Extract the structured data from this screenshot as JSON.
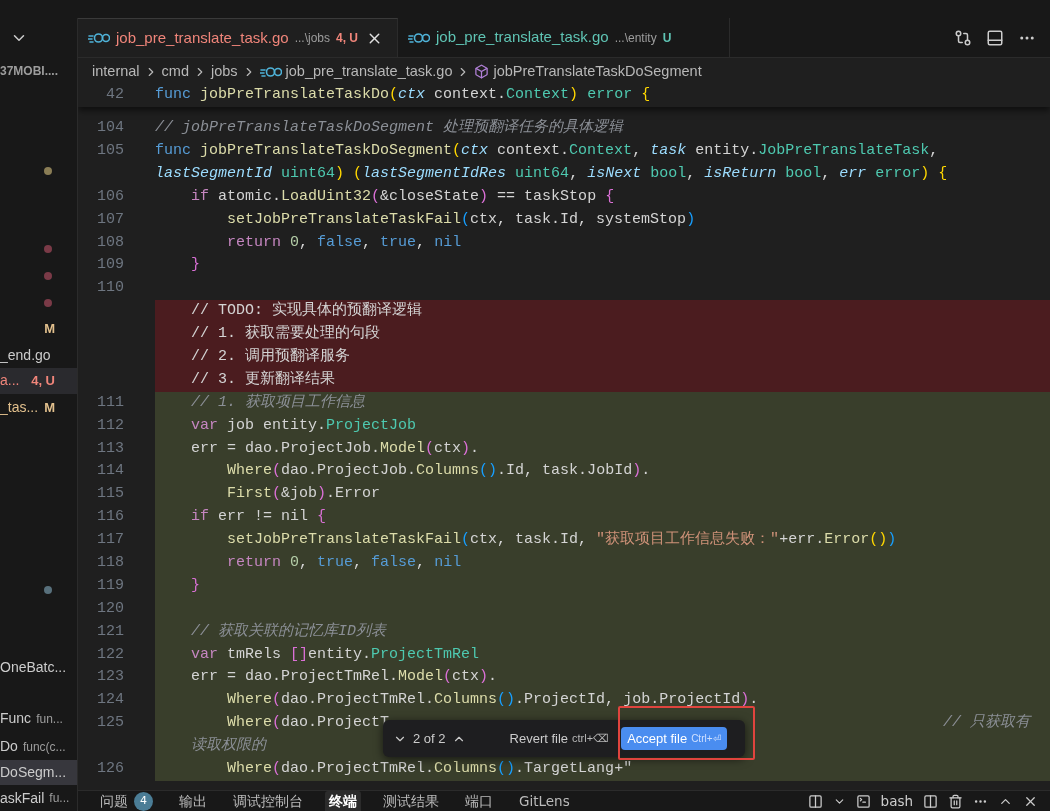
{
  "tabs": [
    {
      "label": "job_pre_translate_task.go",
      "path": "...\\jobs",
      "status": "4, U",
      "color": "#f0857a",
      "selected": true
    },
    {
      "label": "job_pre_translate_task.go",
      "path": "...\\entity",
      "status": "U",
      "color": "#5fc4b4",
      "selected": false
    }
  ],
  "breadcrumb": {
    "folders": [
      "internal",
      "cmd",
      "jobs"
    ],
    "file": "job_pre_translate_task.go",
    "symbol": "jobPreTranslateTaskDoSegment"
  },
  "sidebar": {
    "header": "37MOBI....",
    "items": [
      {
        "kind": "dot",
        "color": "#8a7d55"
      },
      {
        "kind": "dot",
        "color": "#7a3a47"
      },
      {
        "kind": "dot",
        "color": "#7a3a47"
      },
      {
        "kind": "dot",
        "color": "#7a3a47"
      },
      {
        "kind": "file",
        "badge": "M",
        "color": "#e2c08d",
        "selected": false
      },
      {
        "kind": "file",
        "name": "_end.go",
        "color": "#cccccc",
        "selected": false
      },
      {
        "kind": "file",
        "name": "a...",
        "badge": "4, U",
        "color": "#f0857a",
        "selected": true
      },
      {
        "kind": "file",
        "name": "_tas...",
        "badge": "M",
        "color": "#e2c08d",
        "selected": false
      },
      {
        "kind": "dot",
        "color": "#58707c"
      },
      {
        "kind": "outline",
        "name": "OneBatc...",
        "selected": false
      },
      {
        "kind": "outline",
        "name": "Func",
        "detail": "fun...",
        "selected": false
      },
      {
        "kind": "outline",
        "name": "Do",
        "detail": "func(c...",
        "selected": false
      },
      {
        "kind": "outline",
        "name": "DoSegm...",
        "selected": true
      },
      {
        "kind": "outline",
        "name": "askFail",
        "detail": "fu...",
        "selected": false
      }
    ]
  },
  "sticky_line": {
    "number": "42",
    "tokens": [
      {
        "text": "func ",
        "kind": "keyword"
      },
      {
        "text": "jobPreTranslateTaskDo",
        "kind": "function"
      },
      {
        "text": "(",
        "kind": "brace"
      },
      {
        "text": "ctx ",
        "kind": "param"
      },
      {
        "text": "context.",
        "kind": "plain"
      },
      {
        "text": "Context",
        "kind": "type"
      },
      {
        "text": ") ",
        "kind": "brace"
      },
      {
        "text": "error ",
        "kind": "type"
      },
      {
        "text": "{",
        "kind": "brace"
      }
    ]
  },
  "code_lines": [
    {
      "number": "104",
      "kind": "context",
      "tokens": [
        {
          "text": "// jobPreTranslateTaskDoSegment 处理预翻译任务的具体逻辑",
          "kind": "comment"
        }
      ]
    },
    {
      "number": "105",
      "kind": "context",
      "tokens": [
        {
          "text": "func ",
          "kind": "keyword"
        },
        {
          "text": "jobPreTranslateTaskDoSegment",
          "kind": "function"
        },
        {
          "text": "(",
          "kind": "brace"
        },
        {
          "text": "ctx ",
          "kind": "param"
        },
        {
          "text": "context.",
          "kind": "plain"
        },
        {
          "text": "Context",
          "kind": "type"
        },
        {
          "text": ", ",
          "kind": "plain"
        },
        {
          "text": "task ",
          "kind": "param"
        },
        {
          "text": "entity.",
          "kind": "plain"
        },
        {
          "text": "JobPreTranslateTask",
          "kind": "type"
        },
        {
          "text": ",",
          "kind": "plain"
        }
      ]
    },
    {
      "kind": "context",
      "tokens": [
        {
          "text": "lastSegmentId ",
          "kind": "param"
        },
        {
          "text": "uint64",
          "kind": "type"
        },
        {
          "text": ") ",
          "kind": "brace"
        },
        {
          "text": "(",
          "kind": "brace"
        },
        {
          "text": "lastSegmentIdRes ",
          "kind": "param"
        },
        {
          "text": "uint64",
          "kind": "type"
        },
        {
          "text": ", ",
          "kind": "plain"
        },
        {
          "text": "isNext ",
          "kind": "param"
        },
        {
          "text": "bool",
          "kind": "type"
        },
        {
          "text": ", ",
          "kind": "plain"
        },
        {
          "text": "isReturn ",
          "kind": "param"
        },
        {
          "text": "bool",
          "kind": "type"
        },
        {
          "text": ", ",
          "kind": "plain"
        },
        {
          "text": "err ",
          "kind": "param"
        },
        {
          "text": "error",
          "kind": "type"
        },
        {
          "text": ") ",
          "kind": "brace"
        },
        {
          "text": "{",
          "kind": "brace"
        }
      ]
    },
    {
      "number": "106",
      "kind": "context",
      "tokens": [
        {
          "text": "    if ",
          "kind": "control"
        },
        {
          "text": "atomic.",
          "kind": "plain"
        },
        {
          "text": "LoadUint32",
          "kind": "function"
        },
        {
          "text": "(",
          "kind": "paren"
        },
        {
          "text": "&closeState",
          "kind": "plain"
        },
        {
          "text": ")",
          "kind": "paren"
        },
        {
          "text": " == taskStop ",
          "kind": "plain"
        },
        {
          "text": "{",
          "kind": "paren"
        }
      ]
    },
    {
      "number": "107",
      "kind": "context",
      "tokens": [
        {
          "text": "        setJobPreTranslateTaskFail",
          "kind": "function"
        },
        {
          "text": "(",
          "kind": "bracket"
        },
        {
          "text": "ctx, task.Id, systemStop",
          "kind": "plain"
        },
        {
          "text": ")",
          "kind": "bracket"
        }
      ]
    },
    {
      "number": "108",
      "kind": "context",
      "tokens": [
        {
          "text": "        return ",
          "kind": "control"
        },
        {
          "text": "0",
          "kind": "number"
        },
        {
          "text": ", ",
          "kind": "plain"
        },
        {
          "text": "false",
          "kind": "keyword"
        },
        {
          "text": ", ",
          "kind": "plain"
        },
        {
          "text": "true",
          "kind": "keyword"
        },
        {
          "text": ", ",
          "kind": "plain"
        },
        {
          "text": "nil",
          "kind": "keyword"
        }
      ]
    },
    {
      "number": "109",
      "kind": "context",
      "tokens": [
        {
          "text": "    }",
          "kind": "paren"
        }
      ]
    },
    {
      "number": "110",
      "kind": "context"
    },
    {
      "kind": "deleted",
      "tokens": [
        {
          "text": "    // TODO: 实现具体的预翻译逻辑",
          "kind": "plain"
        }
      ]
    },
    {
      "kind": "deleted",
      "tokens": [
        {
          "text": "    // 1. 获取需要处理的句段",
          "kind": "plain"
        }
      ]
    },
    {
      "kind": "deleted",
      "tokens": [
        {
          "text": "    // 2. 调用预翻译服务",
          "kind": "plain"
        }
      ]
    },
    {
      "kind": "deleted",
      "tokens": [
        {
          "text": "    // 3. 更新翻译结果",
          "kind": "plain"
        }
      ]
    },
    {
      "number": "111",
      "kind": "added",
      "tokens": [
        {
          "text": "    // 1. 获取项目工作信息",
          "kind": "comment"
        }
      ]
    },
    {
      "number": "112",
      "kind": "added",
      "tokens": [
        {
          "text": "    var ",
          "kind": "control"
        },
        {
          "text": "job entity.",
          "kind": "plain"
        },
        {
          "text": "ProjectJob",
          "kind": "type"
        }
      ]
    },
    {
      "number": "113",
      "kind": "added",
      "tokens": [
        {
          "text": "    err = dao.ProjectJob.",
          "kind": "plain"
        },
        {
          "text": "Model",
          "kind": "function"
        },
        {
          "text": "(",
          "kind": "paren"
        },
        {
          "text": "ctx",
          "kind": "plain"
        },
        {
          "text": ")",
          "kind": "paren"
        },
        {
          "text": ".",
          "kind": "plain"
        }
      ]
    },
    {
      "number": "114",
      "kind": "added",
      "tokens": [
        {
          "text": "        Where",
          "kind": "function"
        },
        {
          "text": "(",
          "kind": "paren"
        },
        {
          "text": "dao.ProjectJob.",
          "kind": "plain"
        },
        {
          "text": "Columns",
          "kind": "function"
        },
        {
          "text": "()",
          "kind": "bracket"
        },
        {
          "text": ".Id, task.JobId",
          "kind": "plain"
        },
        {
          "text": ")",
          "kind": "paren"
        },
        {
          "text": ".",
          "kind": "plain"
        }
      ]
    },
    {
      "number": "115",
      "kind": "added",
      "tokens": [
        {
          "text": "        First",
          "kind": "function"
        },
        {
          "text": "(",
          "kind": "paren"
        },
        {
          "text": "&job",
          "kind": "plain"
        },
        {
          "text": ")",
          "kind": "paren"
        },
        {
          "text": ".Error",
          "kind": "plain"
        }
      ]
    },
    {
      "number": "116",
      "kind": "added",
      "tokens": [
        {
          "text": "    if ",
          "kind": "control"
        },
        {
          "text": "err != nil ",
          "kind": "plain"
        },
        {
          "text": "{",
          "kind": "paren"
        }
      ]
    },
    {
      "number": "117",
      "kind": "added",
      "tokens": [
        {
          "text": "        setJobPreTranslateTaskFail",
          "kind": "function"
        },
        {
          "text": "(",
          "kind": "bracket"
        },
        {
          "text": "ctx, task.Id, ",
          "kind": "plain"
        },
        {
          "text": "\"获取项目工作信息失败：\"",
          "kind": "string"
        },
        {
          "text": "+err.",
          "kind": "plain"
        },
        {
          "text": "Error",
          "kind": "function"
        },
        {
          "text": "()",
          "kind": "brace"
        },
        {
          "text": ")",
          "kind": "bracket"
        }
      ]
    },
    {
      "number": "118",
      "kind": "added",
      "tokens": [
        {
          "text": "        return ",
          "kind": "control"
        },
        {
          "text": "0",
          "kind": "number"
        },
        {
          "text": ", ",
          "kind": "plain"
        },
        {
          "text": "true",
          "kind": "keyword"
        },
        {
          "text": ", ",
          "kind": "plain"
        },
        {
          "text": "false",
          "kind": "keyword"
        },
        {
          "text": ", ",
          "kind": "plain"
        },
        {
          "text": "nil",
          "kind": "keyword"
        }
      ]
    },
    {
      "number": "119",
      "kind": "added",
      "tokens": [
        {
          "text": "    }",
          "kind": "paren"
        }
      ]
    },
    {
      "number": "120",
      "kind": "added"
    },
    {
      "number": "121",
      "kind": "added",
      "tokens": [
        {
          "text": "    // 获取关联的记忆库ID列表",
          "kind": "comment"
        }
      ]
    },
    {
      "number": "122",
      "kind": "added",
      "tokens": [
        {
          "text": "    var ",
          "kind": "control"
        },
        {
          "text": "tmRels ",
          "kind": "plain"
        },
        {
          "text": "[]",
          "kind": "paren"
        },
        {
          "text": "entity.",
          "kind": "plain"
        },
        {
          "text": "ProjectTmRel",
          "kind": "type"
        }
      ]
    },
    {
      "number": "123",
      "kind": "added",
      "tokens": [
        {
          "text": "    err = dao.ProjectTmRel.",
          "kind": "plain"
        },
        {
          "text": "Model",
          "kind": "function"
        },
        {
          "text": "(",
          "kind": "paren"
        },
        {
          "text": "ctx",
          "kind": "plain"
        },
        {
          "text": ")",
          "kind": "paren"
        },
        {
          "text": ".",
          "kind": "plain"
        }
      ]
    },
    {
      "number": "124",
      "kind": "added",
      "tokens": [
        {
          "text": "        Where",
          "kind": "function"
        },
        {
          "text": "(",
          "kind": "paren"
        },
        {
          "text": "dao.ProjectTmRel.",
          "kind": "plain"
        },
        {
          "text": "Columns",
          "kind": "function"
        },
        {
          "text": "()",
          "kind": "bracket"
        },
        {
          "text": ".ProjectId, job.ProjectId",
          "kind": "plain"
        },
        {
          "text": ")",
          "kind": "paren"
        },
        {
          "text": ".",
          "kind": "plain"
        }
      ]
    },
    {
      "number": "125",
      "kind": "added",
      "tokens": [
        {
          "text": "        Where",
          "kind": "function"
        },
        {
          "text": "(",
          "kind": "paren"
        },
        {
          "text": "dao.ProjectT",
          "kind": "plain"
        }
      ],
      "trailing_comment": "// 只获取有"
    },
    {
      "kind": "added",
      "tokens": [
        {
          "text": "    读取权限的",
          "kind": "comment"
        }
      ]
    },
    {
      "number": "126",
      "kind": "added",
      "tokens": [
        {
          "text": "        Where",
          "kind": "function"
        },
        {
          "text": "(",
          "kind": "paren"
        },
        {
          "text": "dao.ProjectTmRel.",
          "kind": "plain"
        },
        {
          "text": "Columns",
          "kind": "function"
        },
        {
          "text": "()",
          "kind": "bracket"
        },
        {
          "text": ".TargetLang+\"",
          "kind": "plain"
        }
      ]
    }
  ],
  "diff_popup": {
    "counter": "2 of 2",
    "revert": {
      "label": "Revert file",
      "shortcut": "ctrl+⌫"
    },
    "accept": {
      "label": "Accept file",
      "shortcut": "Ctrl+⏎"
    },
    "highlighted": true
  },
  "panel": {
    "tabs": [
      {
        "label": "问题",
        "count": "4",
        "selected": false
      },
      {
        "label": "输出",
        "selected": false
      },
      {
        "label": "调试控制台",
        "selected": false
      },
      {
        "label": "终端",
        "selected": true
      },
      {
        "label": "测试结果",
        "selected": false
      },
      {
        "label": "端口",
        "selected": false
      },
      {
        "label": "GitLens",
        "selected": false
      }
    ],
    "shell": "bash"
  }
}
